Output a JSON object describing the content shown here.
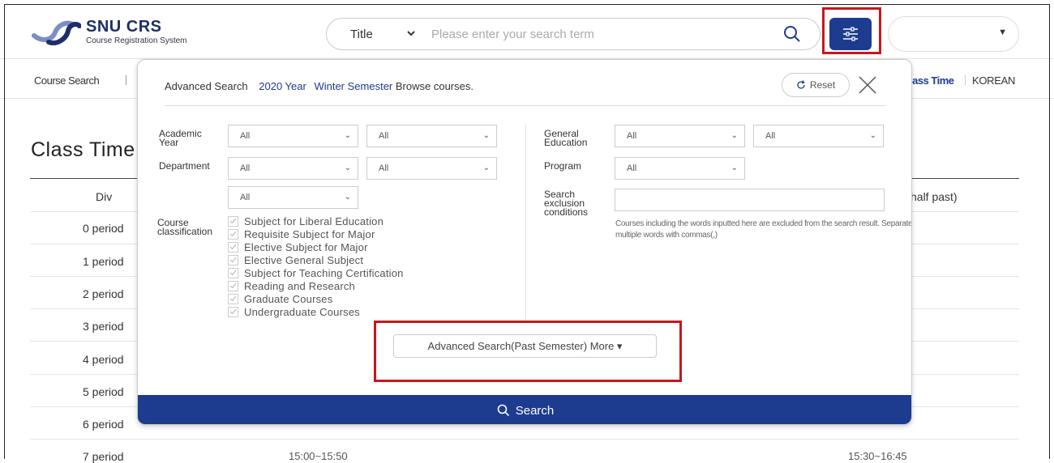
{
  "brand": {
    "title": "SNU CRS",
    "subtitle": "Course Registration System",
    "color": "#1d2e6b"
  },
  "search": {
    "type_selected": "Title",
    "placeholder": "Please enter your search term",
    "value": ""
  },
  "nav": {
    "course_search": "Course Search",
    "class_time": "lass Time",
    "language": "KOREAN"
  },
  "page": {
    "title": "Class Time",
    "columns": {
      "div": "Div",
      "half_past": "half past)"
    },
    "periods": [
      "0 period",
      "1 period",
      "2 period",
      "3 period",
      "4 period",
      "5 period",
      "6 period",
      "7 period"
    ],
    "row7": {
      "time_a": "15:00~15:50",
      "time_b": "15:30~16:45"
    }
  },
  "modal": {
    "heading": "Advanced Search",
    "year": "2020 Year",
    "semester": "Winter Semester",
    "browse": "Browse courses.",
    "reset_label": "Reset",
    "filters": {
      "academic_year_label": "Academic Year",
      "department_label": "Department",
      "course_classification_label": "Course classification",
      "general_education_label": "General Education",
      "program_label": "Program",
      "search_exclusion_label": "Search exclusion conditions",
      "all": "All"
    },
    "classifications": [
      "Subject for Liberal Education",
      "Requisite Subject for Major",
      "Elective Subject for Major",
      "Elective General Subject",
      "Subject for Teaching Certification",
      "Reading and Research",
      "Graduate Courses",
      "Undergraduate Courses"
    ],
    "exclusion_note": "Courses including the words inputted here are excluded from the search result. Separate multiple words with commas(,)",
    "more_label": "Advanced Search(Past Semester) More ▾",
    "search_label": "Search"
  },
  "colors": {
    "accent": "#1d3b8f",
    "highlight": "#c8161d"
  }
}
